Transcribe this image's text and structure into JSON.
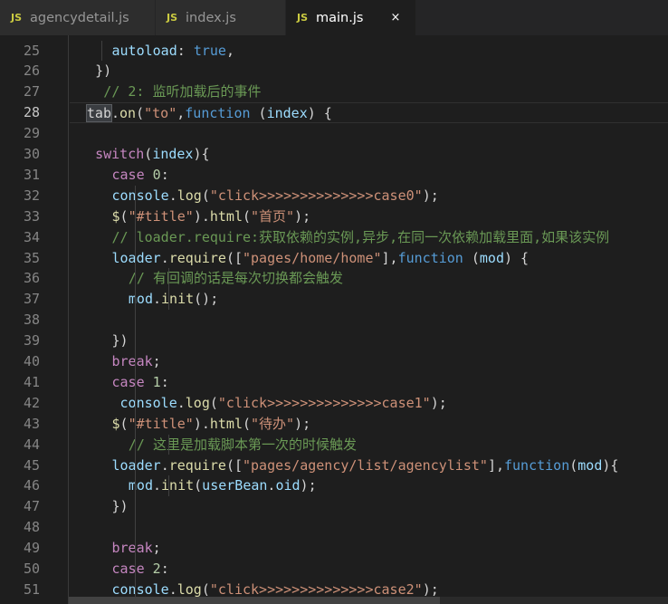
{
  "tabs": [
    {
      "icon": "JS",
      "label": "agencydetail.js",
      "active": false
    },
    {
      "icon": "JS",
      "label": "index.js",
      "active": false
    },
    {
      "icon": "JS",
      "label": "main.js",
      "active": true,
      "close": "×"
    }
  ],
  "editor": {
    "current_line": "28",
    "lines": [
      {
        "n": "25",
        "indent": 5,
        "t": [
          [
            "prop",
            "autoload"
          ],
          [
            "punc",
            ": "
          ],
          [
            "kw",
            "true"
          ],
          [
            "punc",
            ","
          ]
        ]
      },
      {
        "n": "26",
        "indent": 3,
        "t": [
          [
            "punc",
            "})"
          ]
        ]
      },
      {
        "n": "27",
        "indent": 4,
        "t": [
          [
            "com",
            "// 2: 监听加载后的事件"
          ]
        ]
      },
      {
        "n": "28",
        "indent": 2,
        "t": [
          [
            "hl",
            "tab"
          ],
          [
            "punc",
            "."
          ],
          [
            "fn",
            "on"
          ],
          [
            "punc",
            "("
          ],
          [
            "str",
            "\"to\""
          ],
          [
            "punc",
            ","
          ],
          [
            "kw",
            "function"
          ],
          [
            "punc",
            " ("
          ],
          [
            "prop",
            "index"
          ],
          [
            "punc",
            ") {"
          ]
        ]
      },
      {
        "n": "29",
        "indent": 0,
        "t": []
      },
      {
        "n": "30",
        "indent": 3,
        "t": [
          [
            "ctrl",
            "switch"
          ],
          [
            "punc",
            "("
          ],
          [
            "prop",
            "index"
          ],
          [
            "punc",
            "){"
          ]
        ]
      },
      {
        "n": "31",
        "indent": 5,
        "t": [
          [
            "ctrl",
            "case"
          ],
          [
            "punc",
            " "
          ],
          [
            "num",
            "0"
          ],
          [
            "punc",
            ":"
          ]
        ]
      },
      {
        "n": "32",
        "indent": 5,
        "t": [
          [
            "prop",
            "console"
          ],
          [
            "punc",
            "."
          ],
          [
            "fn",
            "log"
          ],
          [
            "punc",
            "("
          ],
          [
            "str",
            "\"click>>>>>>>>>>>>>>case0\""
          ],
          [
            "punc",
            ");"
          ]
        ]
      },
      {
        "n": "33",
        "indent": 5,
        "t": [
          [
            "fn",
            "$"
          ],
          [
            "punc",
            "("
          ],
          [
            "str",
            "\"#title\""
          ],
          [
            "punc",
            ")."
          ],
          [
            "fn",
            "html"
          ],
          [
            "punc",
            "("
          ],
          [
            "str",
            "\"首页\""
          ],
          [
            "punc",
            ");"
          ]
        ]
      },
      {
        "n": "34",
        "indent": 5,
        "t": [
          [
            "com",
            "// loader.require:获取依赖的实例,异步,在同一次依赖加载里面,如果该实例"
          ]
        ]
      },
      {
        "n": "35",
        "indent": 5,
        "t": [
          [
            "prop",
            "loader"
          ],
          [
            "punc",
            "."
          ],
          [
            "fn",
            "require"
          ],
          [
            "punc",
            "(["
          ],
          [
            "str",
            "\"pages/home/home\""
          ],
          [
            "punc",
            "],"
          ],
          [
            "kw",
            "function"
          ],
          [
            "punc",
            " ("
          ],
          [
            "prop",
            "mod"
          ],
          [
            "punc",
            ") {"
          ]
        ]
      },
      {
        "n": "36",
        "indent": 7,
        "t": [
          [
            "com",
            "// 有回调的话是每次切换都会触发"
          ]
        ]
      },
      {
        "n": "37",
        "indent": 7,
        "t": [
          [
            "prop",
            "mod"
          ],
          [
            "punc",
            "."
          ],
          [
            "fn",
            "init"
          ],
          [
            "punc",
            "();"
          ]
        ]
      },
      {
        "n": "38",
        "indent": 0,
        "t": []
      },
      {
        "n": "39",
        "indent": 5,
        "t": [
          [
            "punc",
            "})"
          ]
        ]
      },
      {
        "n": "40",
        "indent": 5,
        "t": [
          [
            "ctrl",
            "break"
          ],
          [
            "punc",
            ";"
          ]
        ]
      },
      {
        "n": "41",
        "indent": 5,
        "t": [
          [
            "ctrl",
            "case"
          ],
          [
            "punc",
            " "
          ],
          [
            "num",
            "1"
          ],
          [
            "punc",
            ":"
          ]
        ]
      },
      {
        "n": "42",
        "indent": 5,
        "t": [
          [
            "punc",
            " "
          ],
          [
            "prop",
            "console"
          ],
          [
            "punc",
            "."
          ],
          [
            "fn",
            "log"
          ],
          [
            "punc",
            "("
          ],
          [
            "str",
            "\"click>>>>>>>>>>>>>>case1\""
          ],
          [
            "punc",
            ");"
          ]
        ]
      },
      {
        "n": "43",
        "indent": 5,
        "t": [
          [
            "fn",
            "$"
          ],
          [
            "punc",
            "("
          ],
          [
            "str",
            "\"#title\""
          ],
          [
            "punc",
            ")."
          ],
          [
            "fn",
            "html"
          ],
          [
            "punc",
            "("
          ],
          [
            "str",
            "\"待办\""
          ],
          [
            "punc",
            ");"
          ]
        ]
      },
      {
        "n": "44",
        "indent": 7,
        "t": [
          [
            "com",
            "// 这里是加载脚本第一次的时候触发"
          ]
        ]
      },
      {
        "n": "45",
        "indent": 5,
        "t": [
          [
            "prop",
            "loader"
          ],
          [
            "punc",
            "."
          ],
          [
            "fn",
            "require"
          ],
          [
            "punc",
            "(["
          ],
          [
            "str",
            "\"pages/agency/list/agencylist\""
          ],
          [
            "punc",
            "],"
          ],
          [
            "kw",
            "function"
          ],
          [
            "punc",
            "("
          ],
          [
            "prop",
            "mod"
          ],
          [
            "punc",
            "){"
          ]
        ]
      },
      {
        "n": "46",
        "indent": 7,
        "t": [
          [
            "prop",
            "mod"
          ],
          [
            "punc",
            "."
          ],
          [
            "fn",
            "init"
          ],
          [
            "punc",
            "("
          ],
          [
            "prop",
            "userBean"
          ],
          [
            "punc",
            "."
          ],
          [
            "prop",
            "oid"
          ],
          [
            "punc",
            ");"
          ]
        ]
      },
      {
        "n": "47",
        "indent": 5,
        "t": [
          [
            "punc",
            "})"
          ]
        ]
      },
      {
        "n": "48",
        "indent": 0,
        "t": []
      },
      {
        "n": "49",
        "indent": 5,
        "t": [
          [
            "ctrl",
            "break"
          ],
          [
            "punc",
            ";"
          ]
        ]
      },
      {
        "n": "50",
        "indent": 5,
        "t": [
          [
            "ctrl",
            "case"
          ],
          [
            "punc",
            " "
          ],
          [
            "num",
            "2"
          ],
          [
            "punc",
            ":"
          ]
        ]
      },
      {
        "n": "51",
        "indent": 5,
        "t": [
          [
            "prop",
            "console"
          ],
          [
            "punc",
            "."
          ],
          [
            "fn",
            "log"
          ],
          [
            "punc",
            "("
          ],
          [
            "str",
            "\"click>>>>>>>>>>>>>>case2\""
          ],
          [
            "punc",
            ");"
          ]
        ]
      }
    ]
  }
}
